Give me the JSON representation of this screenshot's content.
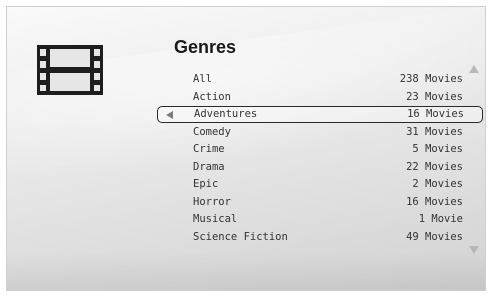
{
  "header": {
    "title": "Genres",
    "icon": "film-strip-icon"
  },
  "genres": [
    {
      "name": "All",
      "count": "238 Movies"
    },
    {
      "name": "Action",
      "count": "23 Movies"
    },
    {
      "name": "Adventures",
      "count": "16 Movies"
    },
    {
      "name": "Comedy",
      "count": "31 Movies"
    },
    {
      "name": "Crime",
      "count": "5 Movies"
    },
    {
      "name": "Drama",
      "count": "22 Movies"
    },
    {
      "name": "Epic",
      "count": "2 Movies"
    },
    {
      "name": "Horror",
      "count": "16 Movies"
    },
    {
      "name": "Musical",
      "count": "1 Movie"
    },
    {
      "name": "Science Fiction",
      "count": "49 Movies"
    }
  ],
  "selected_index": 2,
  "scroll": {
    "up_icon": "scroll-up-icon",
    "down_icon": "scroll-down-icon"
  }
}
